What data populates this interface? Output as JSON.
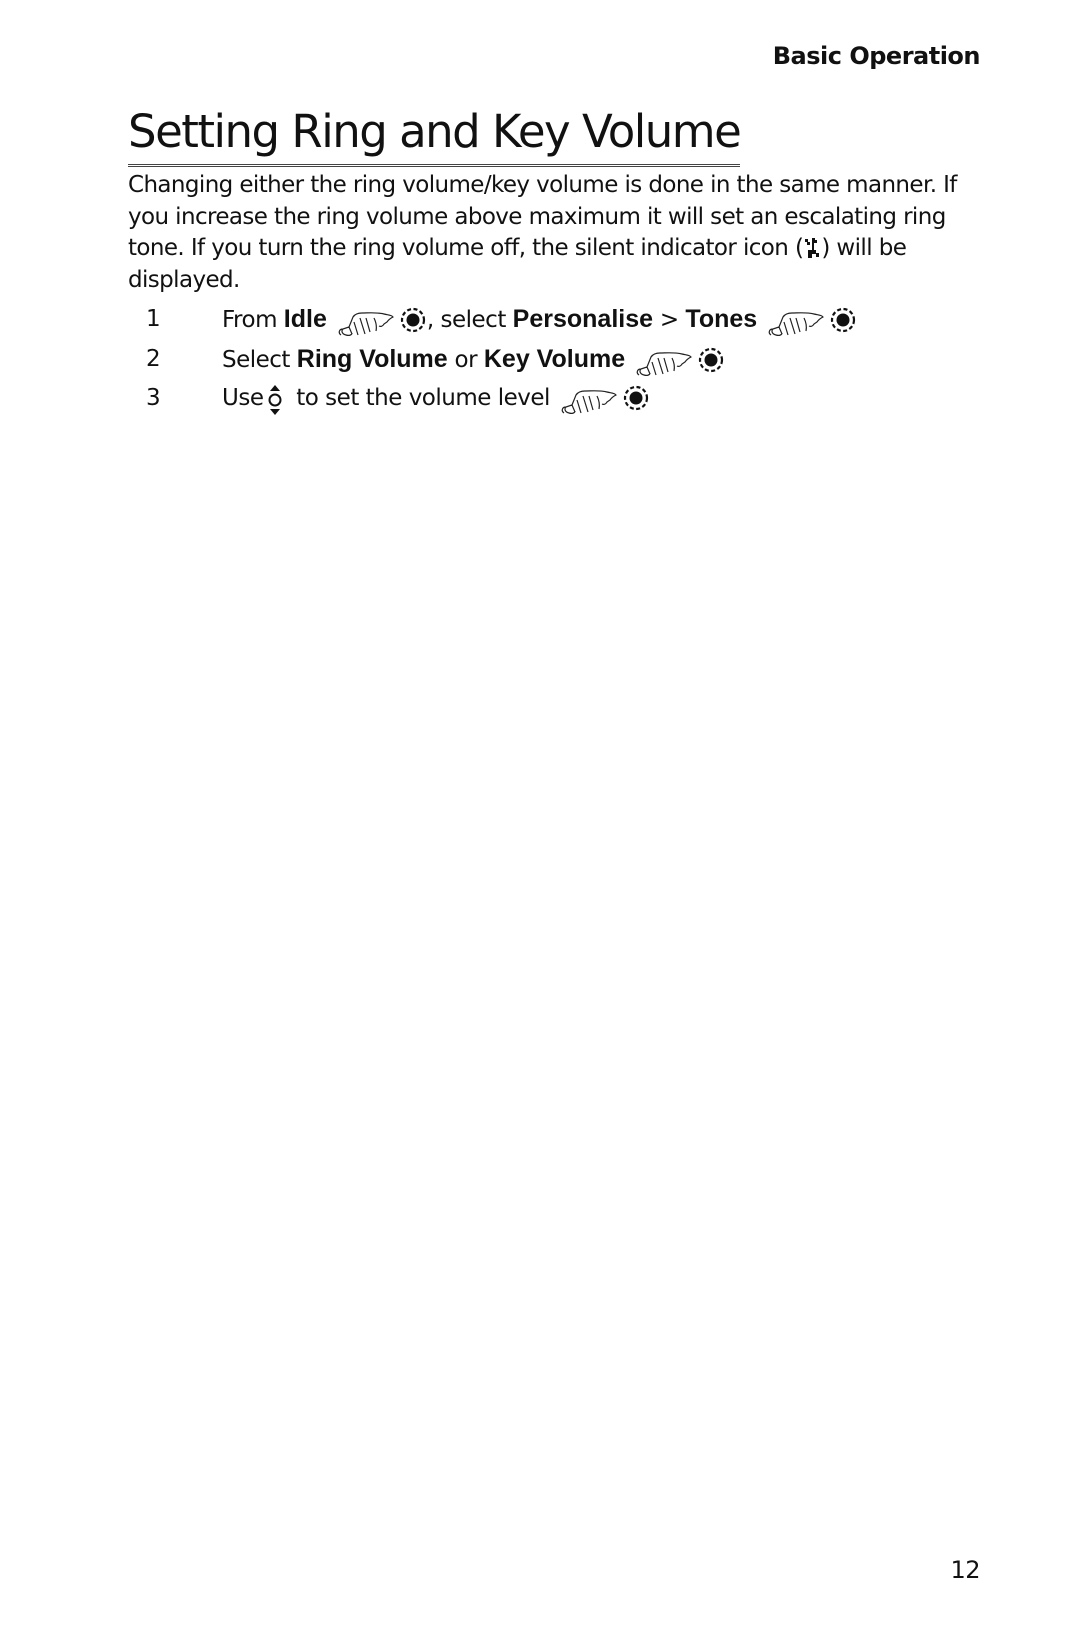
{
  "header": {
    "section": "Basic Operation"
  },
  "title": "Setting Ring and Key Volume",
  "body": {
    "part1": "Changing either the ring volume/key volume is done in the same manner. If you increase the ring volume above maximum it will set an escalating ring tone. If you turn the ring volume off, the silent indicator icon (",
    "icon": "silent-indicator-icon",
    "part2": ") will be displayed."
  },
  "steps": [
    {
      "num": "1",
      "t1": "From ",
      "b1": "Idle",
      "t2": ", select ",
      "b2": "Personalise",
      "t3": " > ",
      "b3": "Tones"
    },
    {
      "num": "2",
      "t1": "Select ",
      "b1": "Ring Volume",
      "t2": " or ",
      "b2": "Key Volume"
    },
    {
      "num": "3",
      "t1": "Use",
      "t2": " to set the volume level"
    }
  ],
  "icons": {
    "press": "hand-press-icon",
    "ok": "ok-key-icon",
    "nav": "up-down-navigation-key-icon"
  },
  "page_number": "12"
}
